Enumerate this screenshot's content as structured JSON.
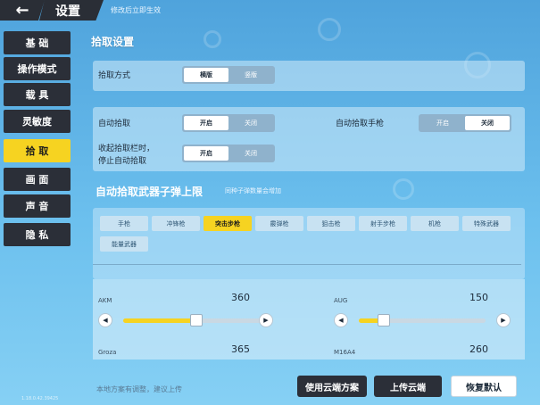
{
  "header": {
    "title": "设置",
    "hint": "修改后立即生效"
  },
  "sidebar": {
    "items": [
      {
        "label": "基 础",
        "active": false
      },
      {
        "label": "操作模式",
        "active": false
      },
      {
        "label": "载 具",
        "active": false
      },
      {
        "label": "灵敏度",
        "active": false
      },
      {
        "label": "拾 取",
        "active": true
      },
      {
        "label": "画 面",
        "active": false
      },
      {
        "label": "声 音",
        "active": false
      },
      {
        "label": "隐 私",
        "active": false
      }
    ],
    "version": "1.18.0.42.39425"
  },
  "pickup": {
    "section_title": "拾取设置",
    "mode_label": "拾取方式",
    "mode_options": [
      "横版",
      "竖版"
    ],
    "mode_selected": "横版",
    "auto_pickup_label": "自动拾取",
    "auto_pickup_options": [
      "开启",
      "关闭"
    ],
    "auto_pickup_selected": "开启",
    "auto_pistol_label": "自动拾取手枪",
    "auto_pistol_options": [
      "开启",
      "关闭"
    ],
    "auto_pistol_selected": "关闭",
    "stop_label_line1": "收起拾取栏时，",
    "stop_label_line2": "停止自动拾取",
    "stop_options": [
      "开启",
      "关闭"
    ],
    "stop_selected": "开启"
  },
  "ammo_limit": {
    "title": "自动拾取武器子弹上限",
    "hint": "同种子弹数量会增加",
    "tabs": [
      "手枪",
      "冲锋枪",
      "突击步枪",
      "霰弹枪",
      "狙击枪",
      "射手步枪",
      "机枪",
      "特殊武器",
      "能量武器"
    ],
    "active_tab": "突击步枪",
    "weapons": [
      {
        "name": "AKM",
        "value": "360",
        "fraction": 0.5
      },
      {
        "name": "AUG",
        "value": "150",
        "fraction": 0.2
      },
      {
        "name": "Groza",
        "value": "365"
      },
      {
        "name": "M16A4",
        "value": "260"
      }
    ]
  },
  "footer": {
    "hint": "本地方案有调整，建议上传",
    "cloud_button": "使用云端方案",
    "upload_button": "上传云端",
    "reset_button": "恢复默认"
  },
  "colors": {
    "accent": "#f6d321",
    "dark": "#2b2f38",
    "background": "#6cc0ee"
  },
  "icons": {
    "back": "arrow-left-icon",
    "prev": "triangle-left-icon",
    "next": "triangle-right-icon"
  }
}
